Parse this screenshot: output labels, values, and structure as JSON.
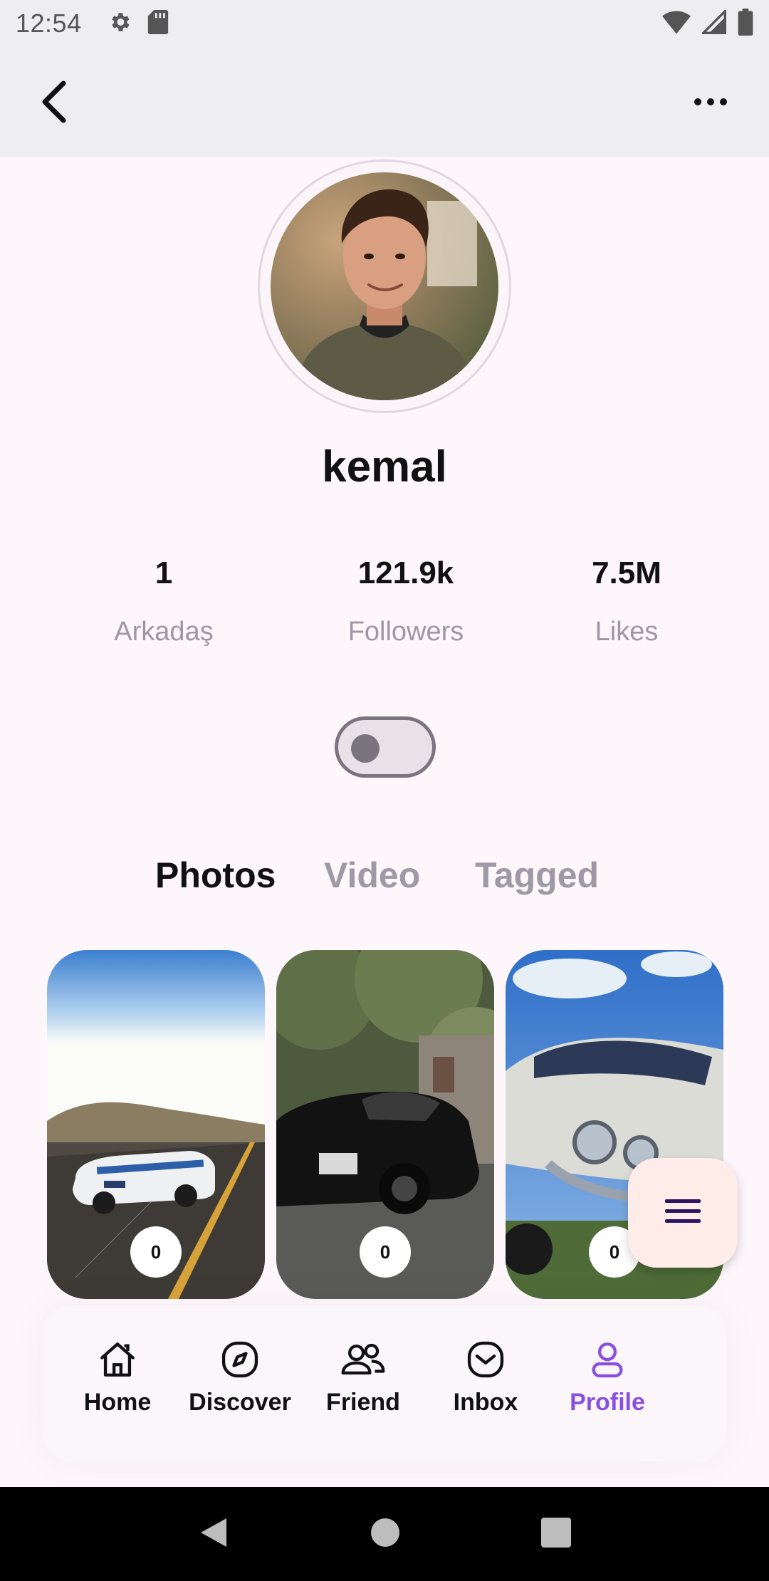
{
  "status_bar": {
    "time": "12:54",
    "left_icons": [
      "gear-icon",
      "sd-card-icon"
    ],
    "right_icons": [
      "wifi-icon",
      "cellular-icon",
      "battery-icon"
    ]
  },
  "app_bar": {
    "back_icon": "chevron-left-icon",
    "more_icon": "more-horizontal-icon"
  },
  "profile": {
    "username": "kemal",
    "stats": [
      {
        "value": "1",
        "label": "Arkadaş"
      },
      {
        "value": "121.9k",
        "label": "Followers"
      },
      {
        "value": "7.5M",
        "label": "Likes"
      }
    ],
    "toggle_on": false
  },
  "tabs": [
    {
      "label": "Photos",
      "active": true
    },
    {
      "label": "Video",
      "active": false
    },
    {
      "label": "Tagged",
      "active": false
    }
  ],
  "cards": [
    {
      "count": "0"
    },
    {
      "count": "0"
    },
    {
      "count": "0"
    }
  ],
  "fab": {
    "icon": "menu-icon"
  },
  "bottom_nav": [
    {
      "label": "Home",
      "icon": "home-icon",
      "active": false
    },
    {
      "label": "Discover",
      "icon": "compass-icon",
      "active": false
    },
    {
      "label": "Friend",
      "icon": "users-icon",
      "active": false
    },
    {
      "label": "Inbox",
      "icon": "inbox-icon",
      "active": false
    },
    {
      "label": "Profile",
      "icon": "profile-icon",
      "active": true
    }
  ],
  "colors": {
    "accent": "#8a4fe0",
    "background": "#fdf6fb",
    "app_bar": "#eeedf0",
    "muted_text": "#9c98a3"
  }
}
